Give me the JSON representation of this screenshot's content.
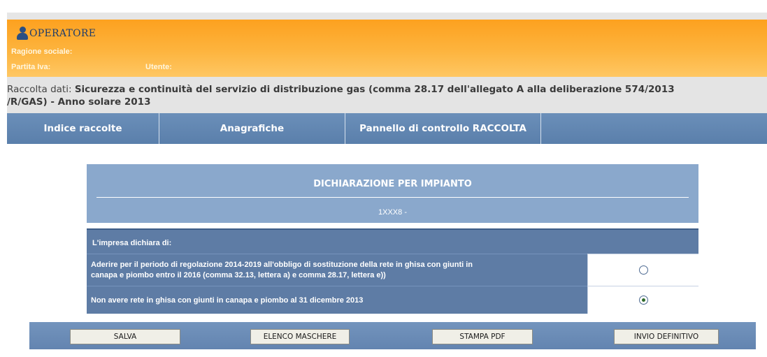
{
  "operator": {
    "title": "OPERATORE",
    "ragione_label": "Ragione sociale:",
    "partita_label": "Partita Iva:",
    "utente_label": "Utente:"
  },
  "raccolta": {
    "prefix": "Raccolta dati:",
    "title_line1": "Sicurezza e continuità del servizio di distribuzione gas (comma 28.17 dell'allegato A alla deliberazione 574/2013",
    "title_line2": "/R/GAS) - Anno solare 2013"
  },
  "nav": {
    "tabs": [
      {
        "label": "Indice raccolte"
      },
      {
        "label": "Anagrafiche"
      },
      {
        "label": "Pannello di controllo RACCOLTA"
      }
    ]
  },
  "declaration": {
    "title": "DICHIARAZIONE PER IMPIANTO",
    "code": "1XXX8 -",
    "intro": "L'impresa dichiara di:",
    "options": [
      {
        "line1": "Aderire per il periodo di regolazione 2014-2019 all'obbligo di sostituzione della rete in ghisa con giunti in",
        "line2": "canapa e piombo entro il 2016 (comma 32.13, lettera a) e comma 28.17, lettera e))",
        "selected": false
      },
      {
        "line1": "Non avere rete in ghisa con giunti in canapa e piombo al 31 dicembre 2013",
        "selected": true
      }
    ]
  },
  "actions": {
    "save": "SALVA",
    "list": "ELENCO MASCHERE",
    "pdf": "STAMPA PDF",
    "submit": "INVIO DEFINITIVO"
  },
  "colors": {
    "operator_bar": "#fda11f",
    "nav_bar": "#6b8fb9",
    "table_blue": "#5e7ca5",
    "header_blue": "#8aa8cc"
  }
}
